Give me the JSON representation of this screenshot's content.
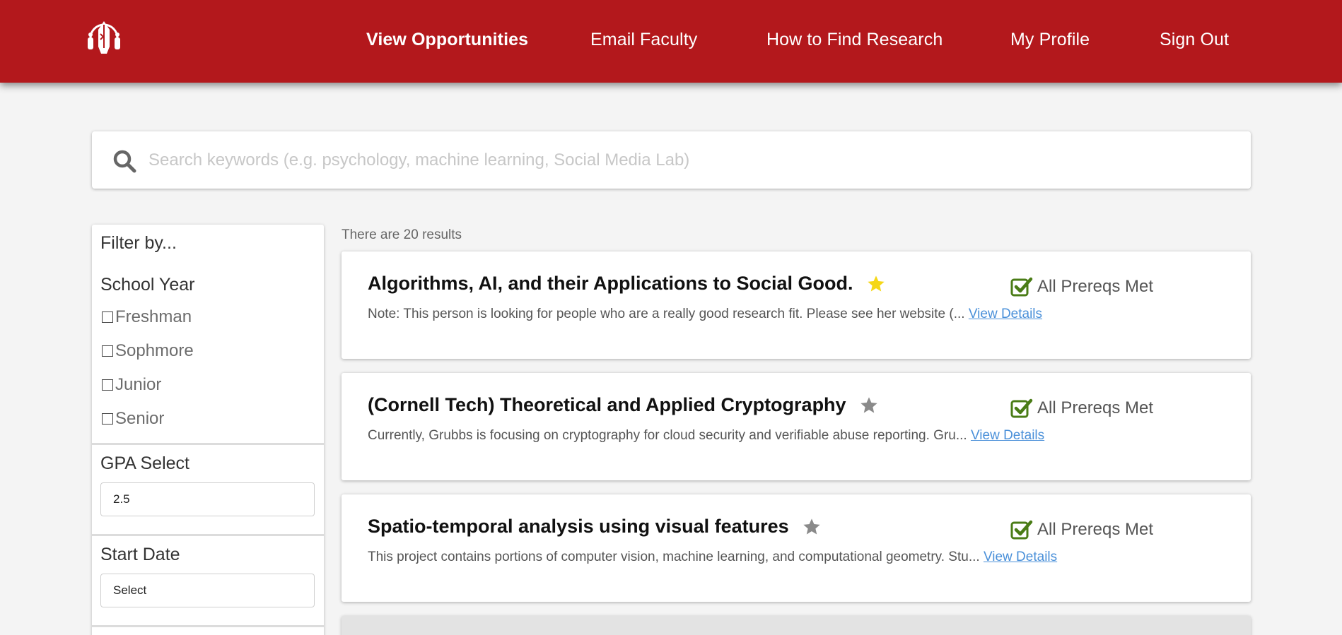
{
  "nav": {
    "items": [
      {
        "label": "View Opportunities",
        "active": true
      },
      {
        "label": "Email Faculty",
        "active": false
      },
      {
        "label": "How to Find Research",
        "active": false
      },
      {
        "label": "My Profile",
        "active": false
      },
      {
        "label": "Sign Out",
        "active": false
      }
    ]
  },
  "search": {
    "placeholder": "Search keywords (e.g. psychology, machine learning, Social Media Lab)",
    "value": ""
  },
  "filters": {
    "title": "Filter by...",
    "school_year": {
      "title": "School Year",
      "options": [
        "Freshman",
        "Sophmore",
        "Junior",
        "Senior"
      ]
    },
    "gpa": {
      "title": "GPA Select",
      "value": "2.5"
    },
    "start_date": {
      "title": "Start Date",
      "value": "Select"
    }
  },
  "results": {
    "count_text": "There are 20 results",
    "items": [
      {
        "title": "Algorithms, AI, and their Applications to Social Good.",
        "starred": true,
        "prereq": "All Prereqs Met",
        "description": "Note: This person is looking for people who are a really good research fit. Please see her website (...",
        "link": "View Details"
      },
      {
        "title": "(Cornell Tech) Theoretical and Applied Cryptography",
        "starred": false,
        "prereq": "All Prereqs Met",
        "description": "Currently, Grubbs is focusing on cryptography for cloud security and verifiable abuse reporting. Gru...",
        "link": "View Details"
      },
      {
        "title": "Spatio-temporal analysis using visual features",
        "starred": false,
        "prereq": "All Prereqs Met",
        "description": "This project contains portions of computer vision, machine learning, and computational geometry. Stu...",
        "link": "View Details"
      }
    ]
  },
  "colors": {
    "brand_red": "#b3181c",
    "star_gold": "#f5d716",
    "star_gray": "#8a8a8a",
    "check_green": "#4a7c16",
    "link_blue": "#4a90d9"
  },
  "icons": {
    "logo": "robot-helmet-logo",
    "search": "search-icon",
    "star": "star-icon",
    "prereq": "checkbox-checked-icon"
  }
}
